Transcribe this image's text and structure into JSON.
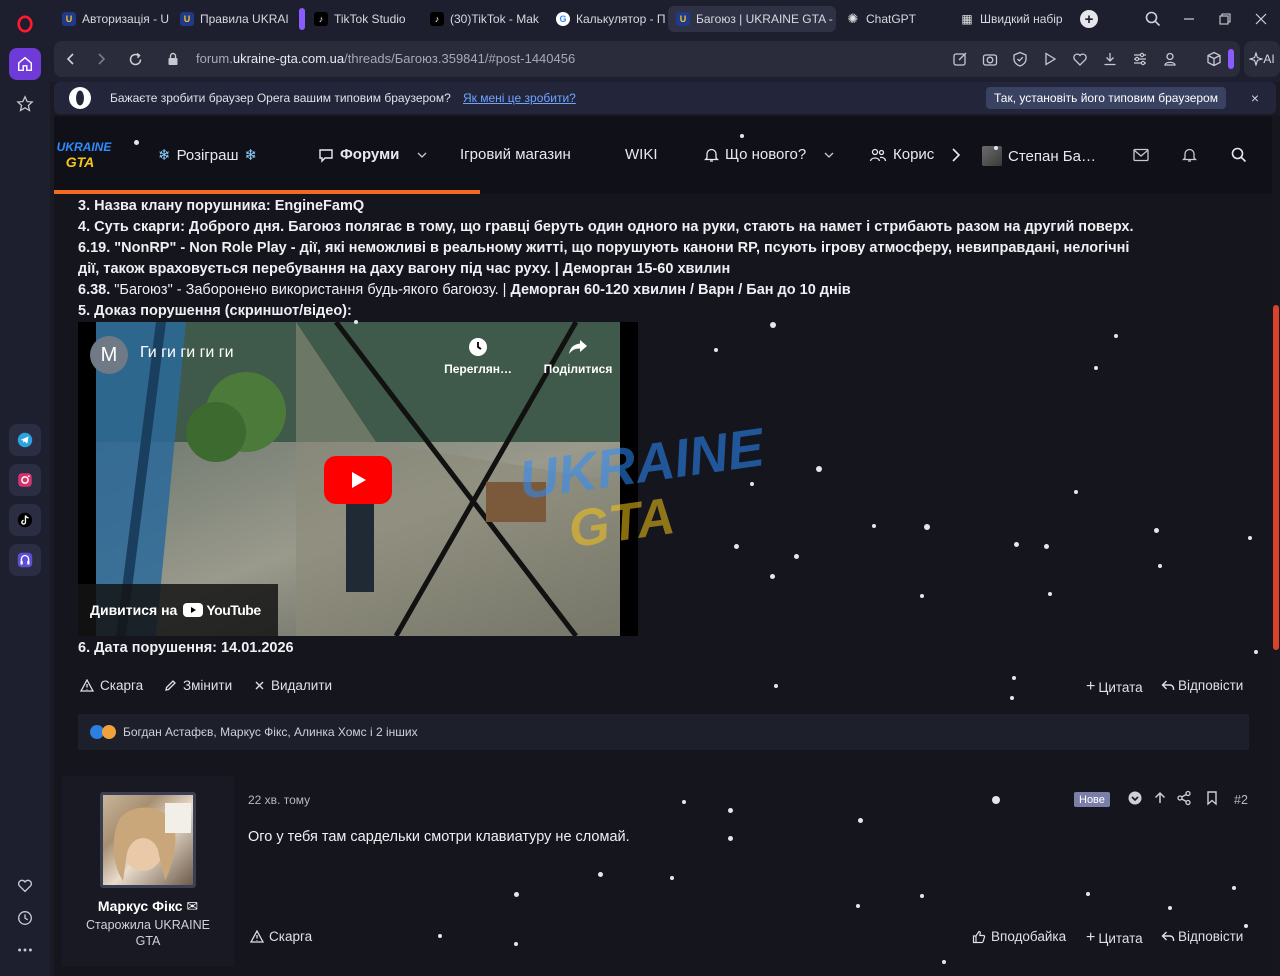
{
  "browser": {
    "tabs": [
      {
        "label": "Авторизація - U",
        "favicon": "ukraine-gta-icon",
        "active": false
      },
      {
        "label": "Правила UKRAIN",
        "favicon": "ukraine-gta-icon",
        "active": false
      },
      {
        "label": "TikTok Studio",
        "favicon": "tiktok-icon",
        "active": false
      },
      {
        "label": "(30)TikTok - Mak",
        "favicon": "tiktok-icon",
        "active": false
      },
      {
        "label": "Калькулятор - П",
        "favicon": "google-icon",
        "active": false
      },
      {
        "label": "Багоюз | UKRAINE GTA - I",
        "favicon": "ukraine-gta-icon",
        "active": true
      },
      {
        "label": "ChatGPT",
        "favicon": "chatgpt-icon",
        "active": false
      },
      {
        "label": "Швидкий набір",
        "favicon": "grid-icon",
        "active": false
      }
    ],
    "url": {
      "prefix": "forum.",
      "domain": "ukraine-gta.com.ua",
      "path": "/threads/Багоюз.359841/#post-1440456"
    },
    "ai_label": "AI",
    "accent_color": "#8a5cff"
  },
  "banner": {
    "text": "Бажаєте зробити браузер Opera вашим типовим браузером?",
    "link": "Як мені це зробити?",
    "button": "Так, установіть його типовим браузером",
    "close": "×"
  },
  "site_nav": {
    "giveaway": "Розіграш",
    "forums": "Форуми",
    "shop": "Ігровий магазин",
    "wiki": "WIKI",
    "whats_new": "Що нового?",
    "users": "Корис",
    "account": "Степан Ба…",
    "header_accent": "#f26a20"
  },
  "post1": {
    "lines": [
      {
        "bold": "3. Назва клану порушника: EngineFamQ",
        "normal": ""
      },
      {
        "bold": "4. Суть скарги: Доброго дня. Багоюз полягає в тому, що гравці беруть один одного на руки, стають на намет і стрибають разом на другий поверх.",
        "normal": ""
      },
      {
        "bold": "6.19. \"NonRP\" - Non Role Play - дії, які неможливі в реальному житті, що порушують канони RP, псують ігрову атмосферу, невиправдані, нелогічні",
        "normal": ""
      },
      {
        "bold": "дії, також враховується перебування на даху вагону під час руху. | Деморган 15-60 хвилин",
        "normal": ""
      },
      {
        "bold": "6.38. ",
        "normal": "\"Багоюз\" - Заборонено використання будь-якого багоюзу. | ",
        "bold2": "Деморган 60-120 хвилин / Варн / Бан до 10 днів"
      },
      {
        "bold": "5. Доказ порушення (скриншот/відео):",
        "normal": ""
      }
    ],
    "video": {
      "channel_letter": "M",
      "title": "Ги ги ги ги ги",
      "watch_later": "Переглян…",
      "share": "Поділитися",
      "watch_on": "Дивитися на",
      "youtube": "YouTube"
    },
    "date_line": "6. Дата порушення: 14.01.2026",
    "actions": {
      "report": "Скарга",
      "edit": "Змінити",
      "delete": "Видалити",
      "quote": "Цитата",
      "reply": "Відповісти"
    },
    "reactions_text": "Богдан Астафєв, Маркус Фікс, Алинка Хомс і 2 інших"
  },
  "post2": {
    "author": "Маркус Фікс",
    "user_title": "Старожила UKRAINE GTA",
    "time": "22 хв. тому",
    "new_badge": "Нове",
    "number": "#2",
    "message": "Ого у тебя там сардельки смотри клавиатуру не сломай.",
    "actions": {
      "report": "Скарга",
      "like": "Вподобайка",
      "quote": "Цитата",
      "reply": "Відповісти"
    }
  },
  "chart_data": null
}
